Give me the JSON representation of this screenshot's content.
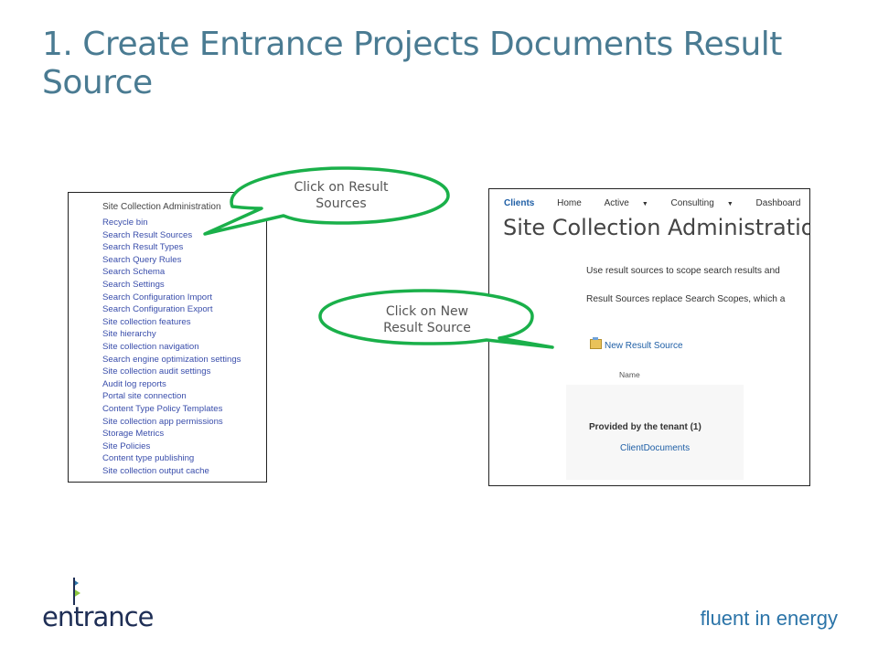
{
  "slide": {
    "title": "1. Create Entrance Projects Documents Result Source"
  },
  "left_screenshot": {
    "heading": "Site Collection Administration",
    "links": [
      "Recycle bin",
      "Search Result Sources",
      "Search Result Types",
      "Search Query Rules",
      "Search Schema",
      "Search Settings",
      "Search Configuration Import",
      "Search Configuration Export",
      "Site collection features",
      "Site hierarchy",
      "Site collection navigation",
      "Search engine optimization settings",
      "Site collection audit settings",
      "Audit log reports",
      "Portal site connection",
      "Content Type Policy Templates",
      "Site collection app permissions",
      "Storage Metrics",
      "Site Policies",
      "Content type publishing",
      "Site collection output cache"
    ]
  },
  "right_screenshot": {
    "nav": {
      "clients": "Clients",
      "home": "Home",
      "active": "Active",
      "consulting": "Consulting",
      "dashboard": "Dashboard"
    },
    "title": "Site Collection Administration",
    "description_1": "Use result sources to scope search results and",
    "description_2": "Result Sources replace Search Scopes, which a",
    "new_result_source": "New Result Source",
    "column_name": "Name",
    "group_label": "Provided by the tenant (1)",
    "item": "ClientDocuments"
  },
  "callouts": {
    "result_sources": {
      "line1": "Click on Result",
      "line2": "Sources"
    },
    "new_result_source": {
      "line1": "Click on New",
      "line2": "Result Source"
    }
  },
  "branding": {
    "logo_text": "entrance",
    "tagline": "fluent in energy",
    "logo_colors": [
      "#2b74a8",
      "#8cc63f",
      "#1e2e55"
    ]
  },
  "colors": {
    "title": "#4a7b92",
    "link": "#3a4eab",
    "callout_outline": "#1ab04a",
    "tagline": "#2b74a8"
  }
}
